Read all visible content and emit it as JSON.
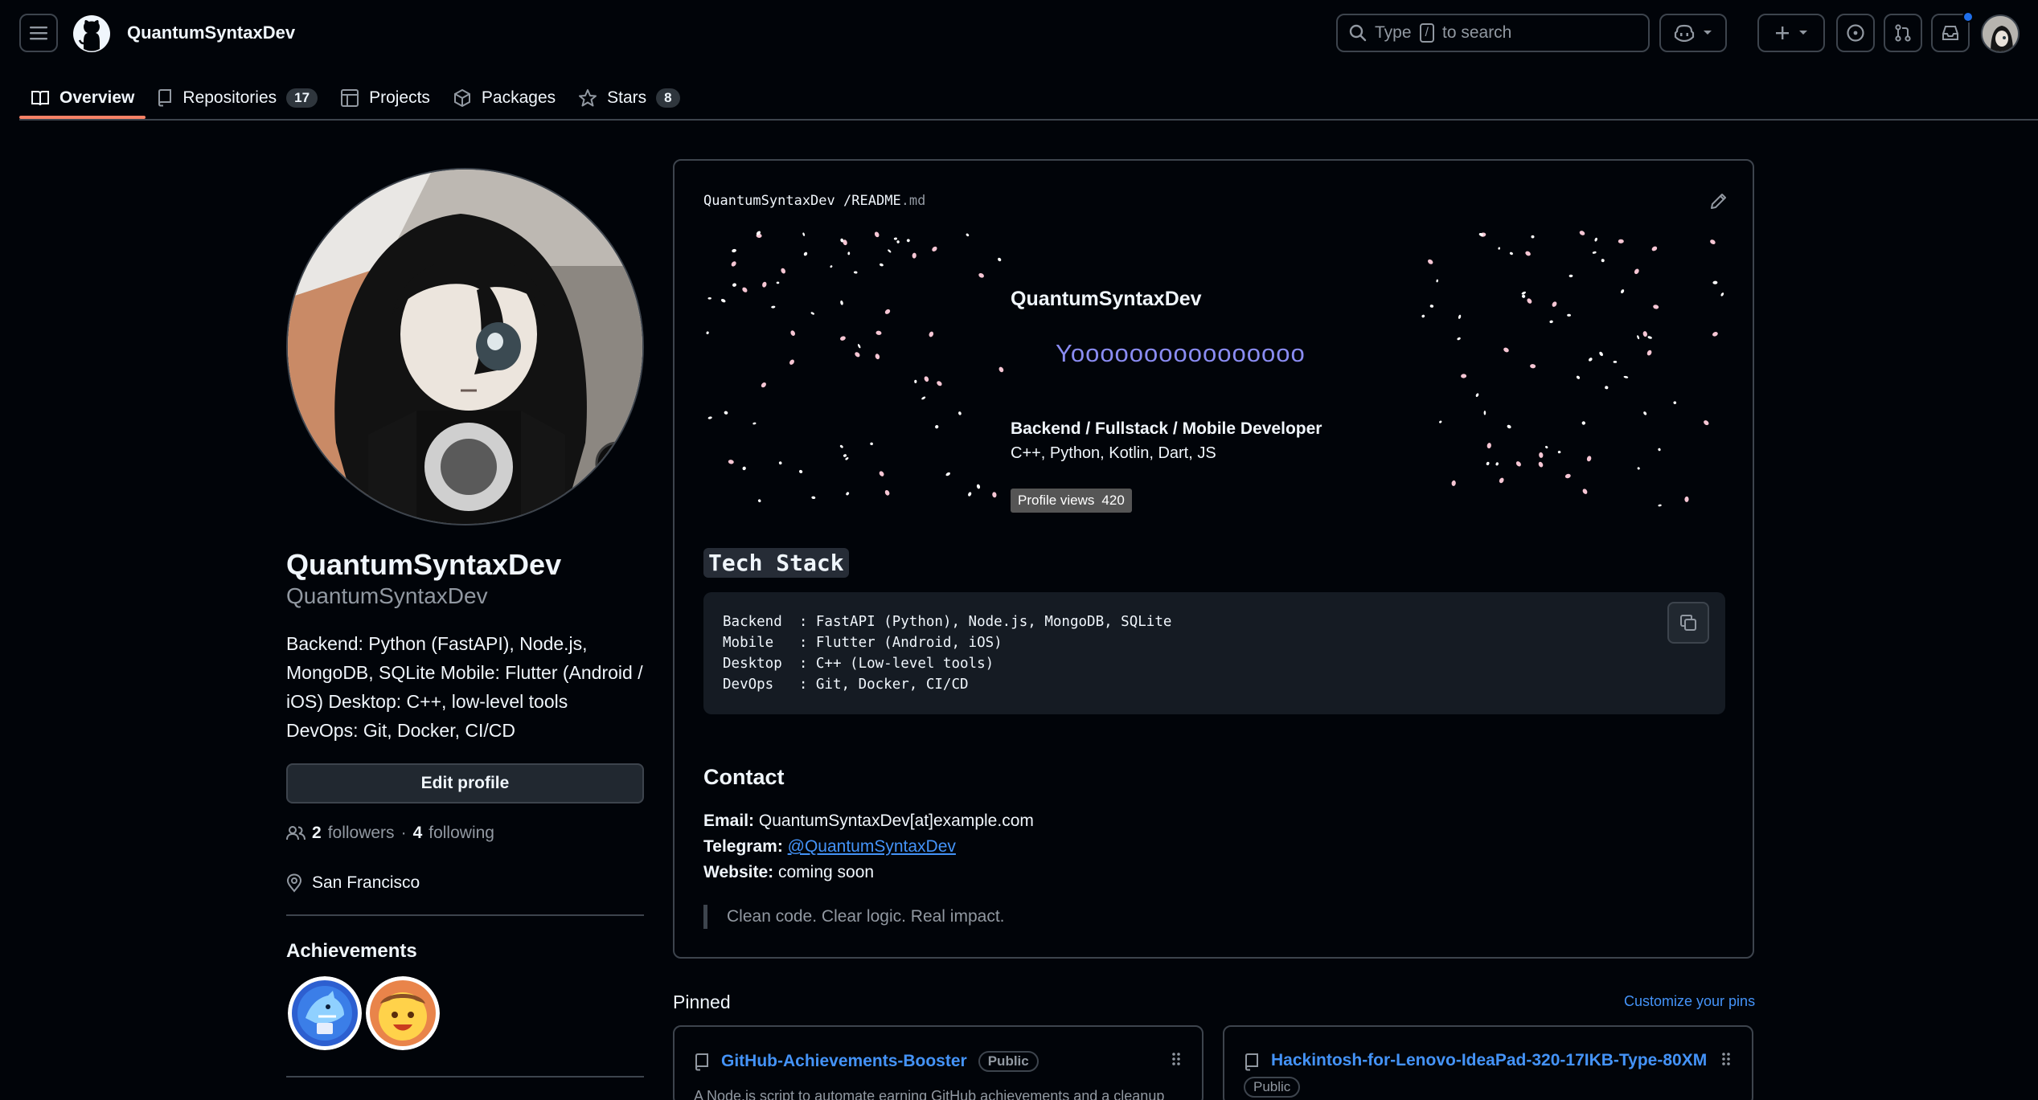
{
  "header": {
    "owner": "QuantumSyntaxDev",
    "search_prefix": "Type",
    "search_key": "/",
    "search_suffix": "to search"
  },
  "tabs": [
    {
      "label": "Overview"
    },
    {
      "label": "Repositories",
      "count": "17"
    },
    {
      "label": "Projects"
    },
    {
      "label": "Packages"
    },
    {
      "label": "Stars",
      "count": "8"
    }
  ],
  "profile": {
    "name": "QuantumSyntaxDev",
    "login": "QuantumSyntaxDev",
    "bio": "Backend: Python (FastAPI), Node.js, MongoDB, SQLite Mobile: Flutter (Android / iOS) Desktop: C++, low-level tools DevOps: Git, Docker, CI/CD",
    "edit_label": "Edit profile",
    "followers_count": "2",
    "followers_label": "followers",
    "separator": "·",
    "following_count": "4",
    "following_label": "following",
    "location": "San Francisco",
    "achievements_title": "Achievements",
    "avatar_mark": "™"
  },
  "readme": {
    "path_owner": "QuantumSyntaxDev",
    "path_sep": "/",
    "path_file": "README",
    "path_ext": ".md",
    "hero_name": "QuantumSyntaxDev",
    "hero_greeting": "Yoooooooooooooooo",
    "hero_role": "Backend / Fullstack / Mobile Developer",
    "hero_langs": "C++, Python, Kotlin, Dart, JS",
    "views_label": "Profile views",
    "views_value": "420",
    "tech_title": "Tech Stack",
    "tech_lines": [
      "Backend  : FastAPI (Python), Node.js, MongoDB, SQLite",
      "Mobile   : Flutter (Android, iOS)",
      "Desktop  : C++ (Low-level tools)",
      "DevOps   : Git, Docker, CI/CD"
    ],
    "contact_title": "Contact",
    "email_label": "Email:",
    "email_value": "QuantumSyntaxDev[at]example.com",
    "telegram_label": "Telegram:",
    "telegram_value": "@QuantumSyntaxDev",
    "website_label": "Website:",
    "website_value": "coming soon",
    "quote": "Clean code. Clear logic. Real impact."
  },
  "pinned": {
    "title": "Pinned",
    "customize": "Customize your pins",
    "repos": [
      {
        "name": "GitHub-Achievements-Booster",
        "visibility": "Public",
        "description": "A Node.js script to automate earning GitHub achievements and a cleanup"
      },
      {
        "name": "Hackintosh-for-Lenovo-IdeaPad-320-17IKB-Type-80XM",
        "visibility": "Public"
      }
    ]
  },
  "colors": {
    "background": "#010409",
    "accent_tab": "#f78166",
    "link": "#4493f8",
    "border": "#3d444d",
    "greeting": "#8a8cf2"
  }
}
